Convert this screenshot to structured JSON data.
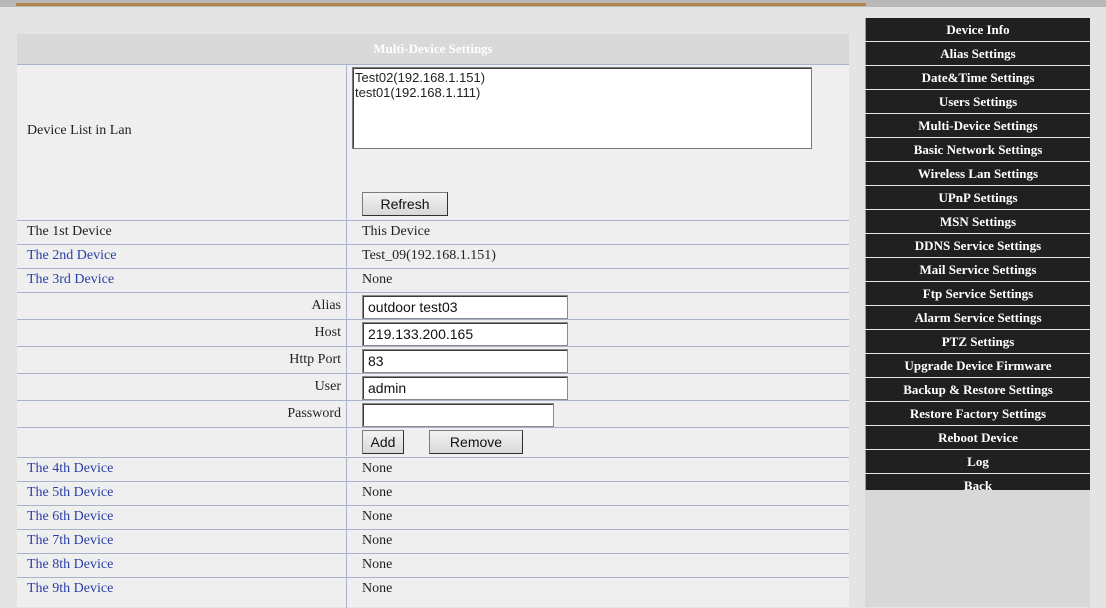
{
  "main": {
    "title": "Multi-Device Settings",
    "device_list_label": "Device List in Lan",
    "device_list_items": [
      "Test02(192.168.1.151)",
      "test01(192.168.1.111)"
    ],
    "refresh_label": "Refresh",
    "devices": [
      {
        "label": "The 1st Device",
        "value": "This Device"
      },
      {
        "label": "The 2nd Device",
        "value": "Test_09(192.168.1.151)"
      },
      {
        "label": "The 3rd Device",
        "value": "None"
      },
      {
        "label": "The 4th Device",
        "value": "None"
      },
      {
        "label": "The 5th Device",
        "value": "None"
      },
      {
        "label": "The 6th Device",
        "value": "None"
      },
      {
        "label": "The 7th Device",
        "value": "None"
      },
      {
        "label": "The 8th Device",
        "value": "None"
      },
      {
        "label": "The 9th Device",
        "value": "None"
      }
    ],
    "form": {
      "alias_label": "Alias",
      "alias_value": "outdoor test03",
      "host_label": "Host",
      "host_value": "219.133.200.165",
      "port_label": "Http Port",
      "port_value": "83",
      "user_label": "User",
      "user_value": "admin",
      "password_label": "Password",
      "password_value": "",
      "add_label": "Add",
      "remove_label": "Remove"
    }
  },
  "menu": {
    "items": [
      "Device Info",
      "Alias Settings",
      "Date&Time Settings",
      "Users Settings",
      "Multi-Device Settings",
      "Basic Network Settings",
      "Wireless Lan Settings",
      "UPnP Settings",
      "MSN Settings",
      "DDNS Service Settings",
      "Mail Service Settings",
      "Ftp Service Settings",
      "Alarm Service Settings",
      "PTZ Settings",
      "Upgrade Device Firmware",
      "Backup & Restore Settings",
      "Restore Factory Settings",
      "Reboot Device",
      "Log",
      "Back"
    ]
  },
  "colors": {
    "link": "#2a3fa6",
    "menu_bg": "#202020",
    "header_bg": "#d9d9d9",
    "accent_bar": "#b48448"
  }
}
